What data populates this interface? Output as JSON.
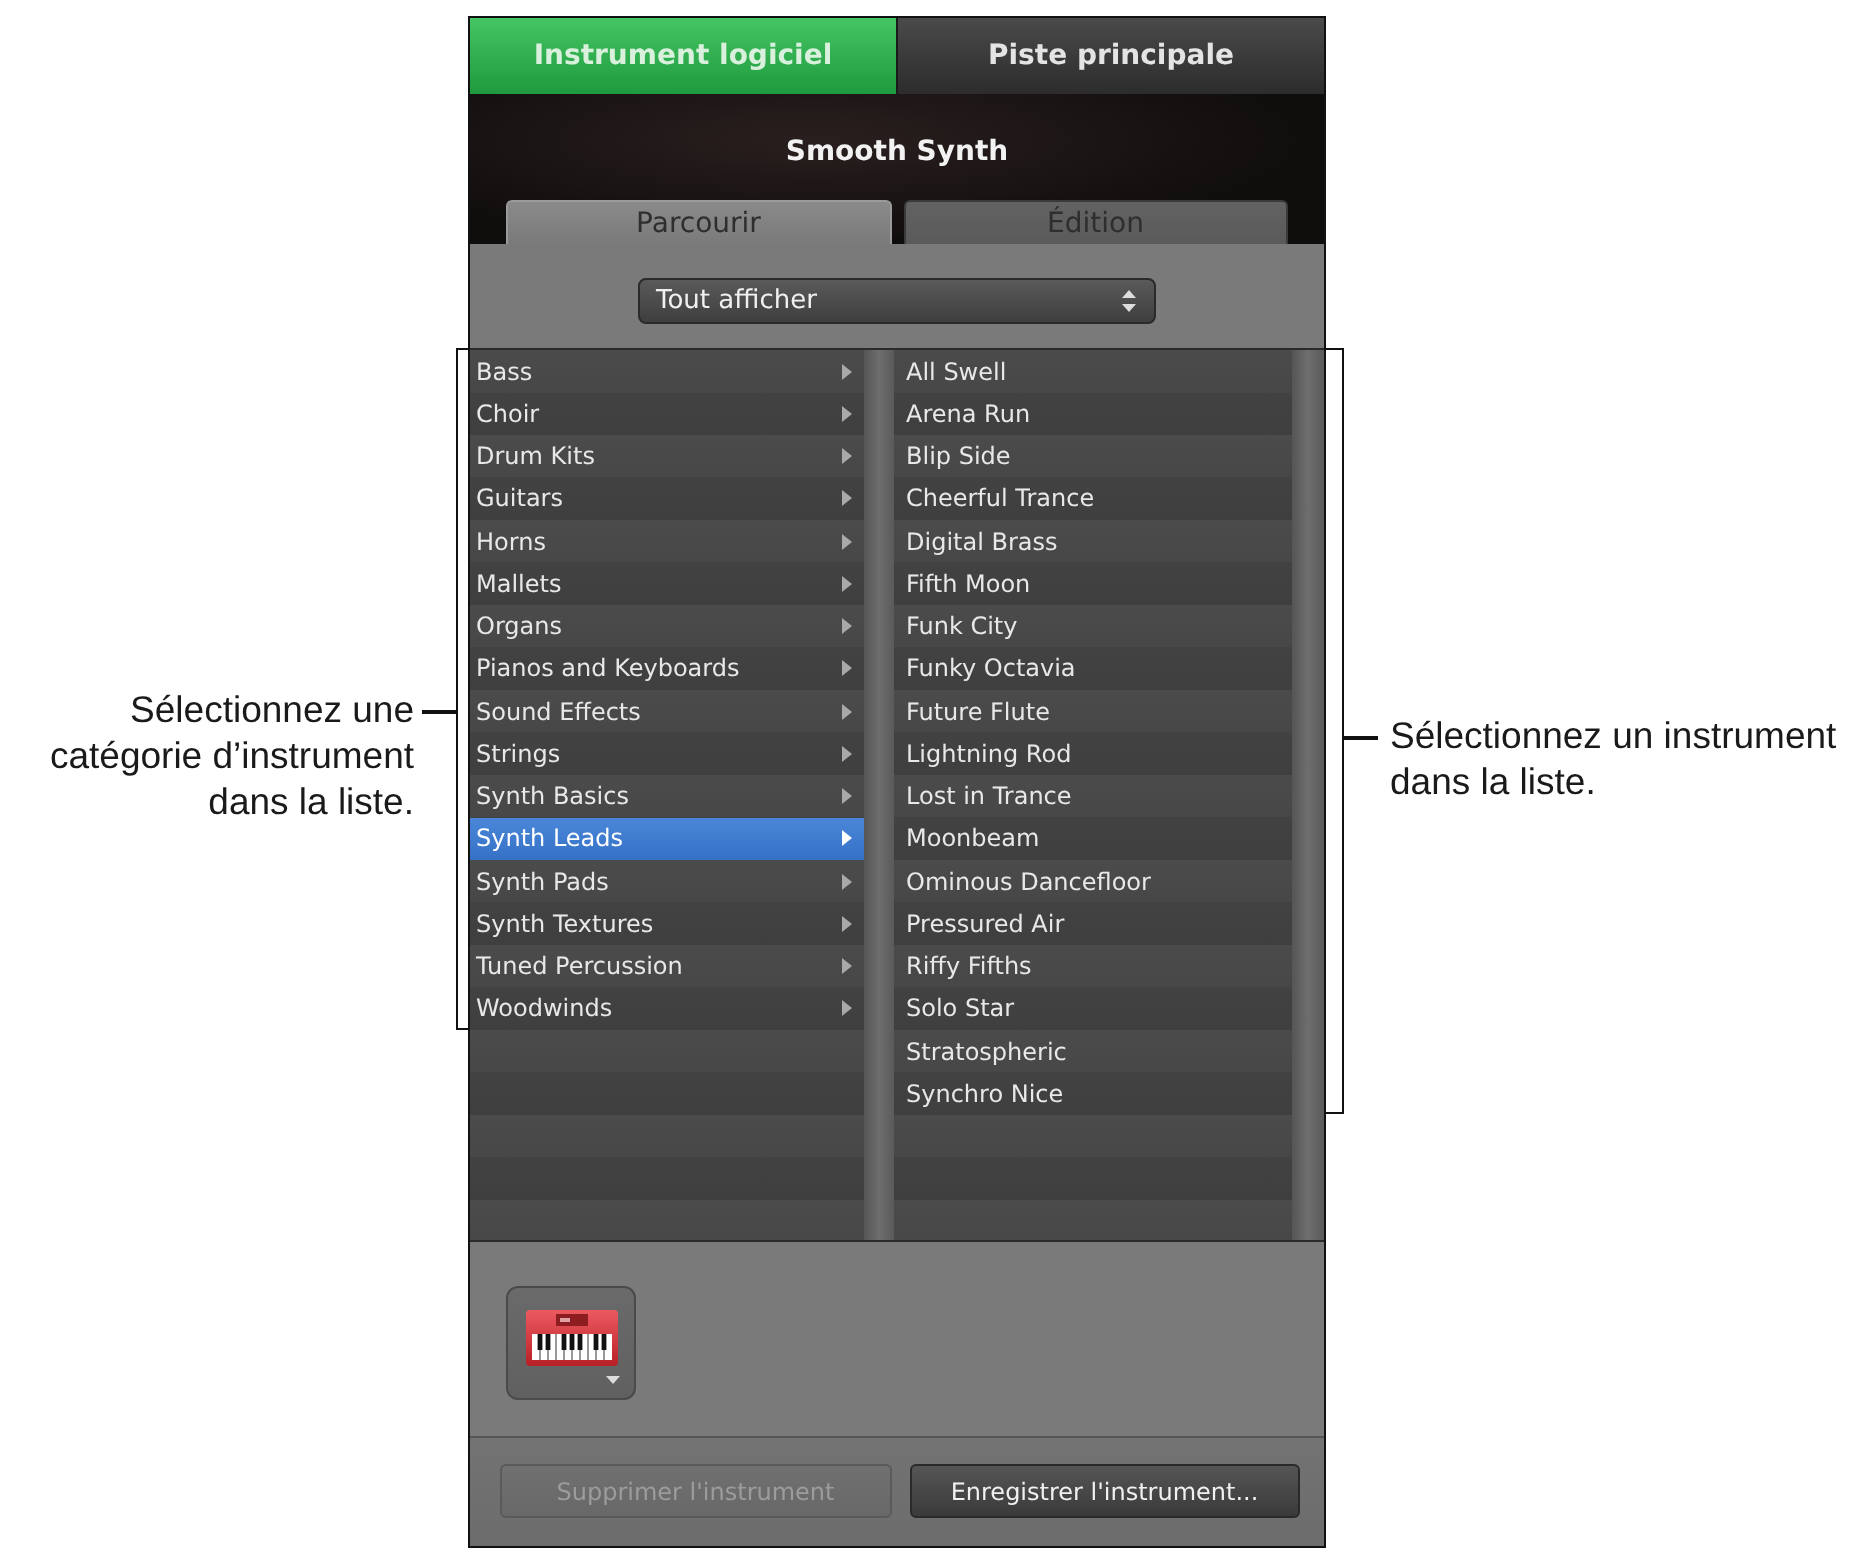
{
  "mode_tabs": [
    {
      "label": "Instrument logiciel",
      "selected": true
    },
    {
      "label": "Piste principale",
      "selected": false
    }
  ],
  "instrument_name": "Smooth Synth",
  "view_tabs": [
    {
      "label": "Parcourir",
      "selected": true
    },
    {
      "label": "Édition",
      "selected": false
    }
  ],
  "filter_popup": {
    "value": "Tout afficher"
  },
  "categories": [
    {
      "label": "Bass",
      "selected": false
    },
    {
      "label": "Choir",
      "selected": false
    },
    {
      "label": "Drum Kits",
      "selected": false
    },
    {
      "label": "Guitars",
      "selected": false
    },
    {
      "label": "Horns",
      "selected": false
    },
    {
      "label": "Mallets",
      "selected": false
    },
    {
      "label": "Organs",
      "selected": false
    },
    {
      "label": "Pianos and Keyboards",
      "selected": false
    },
    {
      "label": "Sound Effects",
      "selected": false
    },
    {
      "label": "Strings",
      "selected": false
    },
    {
      "label": "Synth Basics",
      "selected": false
    },
    {
      "label": "Synth Leads",
      "selected": true
    },
    {
      "label": "Synth Pads",
      "selected": false
    },
    {
      "label": "Synth Textures",
      "selected": false
    },
    {
      "label": "Tuned Percussion",
      "selected": false
    },
    {
      "label": "Woodwinds",
      "selected": false
    }
  ],
  "instruments": [
    {
      "label": "All Swell",
      "selected": false
    },
    {
      "label": "Arena Run",
      "selected": false
    },
    {
      "label": "Blip Side",
      "selected": false
    },
    {
      "label": "Cheerful Trance",
      "selected": false
    },
    {
      "label": "Digital Brass",
      "selected": false
    },
    {
      "label": "Fifth Moon",
      "selected": false
    },
    {
      "label": "Funk City",
      "selected": false
    },
    {
      "label": "Funky Octavia",
      "selected": false
    },
    {
      "label": "Future Flute",
      "selected": false
    },
    {
      "label": "Lightning Rod",
      "selected": false
    },
    {
      "label": "Lost in Trance",
      "selected": false
    },
    {
      "label": "Moonbeam",
      "selected": false
    },
    {
      "label": "Ominous Dancefloor",
      "selected": false
    },
    {
      "label": "Pressured Air",
      "selected": false
    },
    {
      "label": "Riffy Fifths",
      "selected": false
    },
    {
      "label": "Solo Star",
      "selected": false
    },
    {
      "label": "Stratospheric",
      "selected": false
    },
    {
      "label": "Synchro Nice",
      "selected": false
    }
  ],
  "buttons": [
    {
      "label": "Supprimer l'instrument",
      "disabled": true
    },
    {
      "label": "Enregistrer l'instrument...",
      "disabled": false
    }
  ],
  "category_callout": {
    "lines": [
      "Sélectionnez une",
      "catégorie d’instrument",
      "dans la liste."
    ]
  },
  "instrument_callout": {
    "lines": [
      "Sélectionnez un instrument",
      "dans la liste."
    ]
  }
}
